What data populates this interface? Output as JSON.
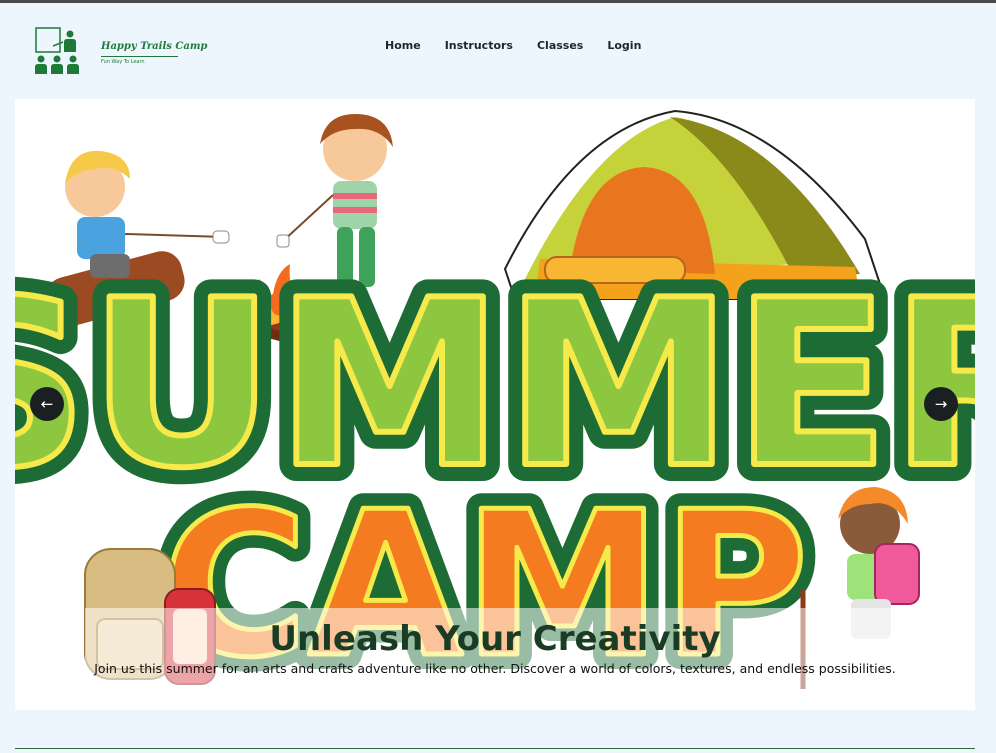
{
  "brand": {
    "name": "Happy Trails Camp",
    "tagline": "Fun Way To Learn",
    "primary_color": "#1f7a3a"
  },
  "nav": {
    "items": [
      {
        "label": "Home"
      },
      {
        "label": "Instructors"
      },
      {
        "label": "Classes"
      },
      {
        "label": "Login"
      }
    ]
  },
  "hero": {
    "image_text_line1": "SUMMER",
    "image_text_line2": "CAMP",
    "title": "Unleash Your Creativity",
    "description": "Join us this summer for an arts and crafts adventure like no other. Discover a world of colors, textures, and endless possibilities.",
    "prev_icon": "arrow-left-icon",
    "next_icon": "arrow-right-icon",
    "prev_glyph": "←",
    "next_glyph": "→"
  },
  "colors": {
    "green_dark": "#1d6b35",
    "green_light": "#8dc63f",
    "orange": "#f47b20",
    "yellow": "#f6e94a"
  }
}
